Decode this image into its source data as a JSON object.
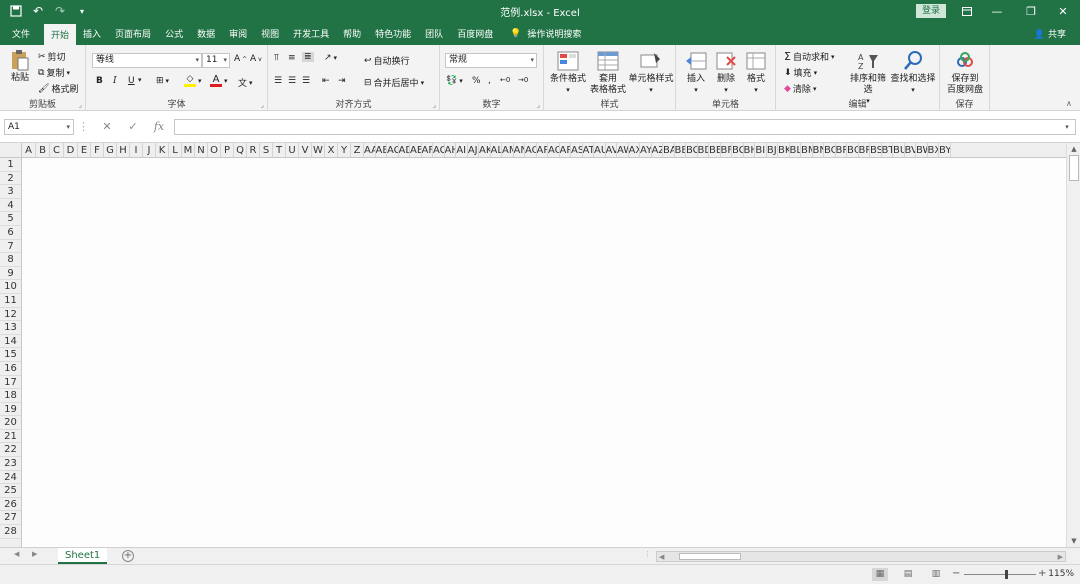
{
  "window": {
    "title": "范例.xlsx - Excel",
    "login_label": "登录",
    "share_label": "共享"
  },
  "tabs": [
    "文件",
    "开始",
    "插入",
    "页面布局",
    "公式",
    "数据",
    "审阅",
    "视图",
    "开发工具",
    "帮助",
    "特色功能",
    "团队",
    "百度网盘",
    "操作说明搜索"
  ],
  "active_tab": "开始",
  "ribbon": {
    "clipboard": {
      "label": "剪贴板",
      "paste": "粘贴",
      "cut": "剪切",
      "copy": "复制",
      "format_painter": "格式刷"
    },
    "font": {
      "label": "字体",
      "font_name": "等线",
      "font_size": "11",
      "bold": "B",
      "italic": "I",
      "underline": "U"
    },
    "alignment": {
      "label": "对齐方式",
      "wrap": "自动换行",
      "merge": "合并后居中"
    },
    "number": {
      "label": "数字",
      "format": "常规",
      "percent": "%"
    },
    "styles": {
      "label": "样式",
      "conditional": "条件格式",
      "table_a": "套用",
      "table_b": "表格格式",
      "cell_styles": "单元格样式"
    },
    "cells": {
      "label": "单元格",
      "insert": "插入",
      "delete": "删除",
      "format": "格式"
    },
    "editing": {
      "label": "编辑",
      "autosum": "自动求和",
      "fill": "填充",
      "clear": "清除",
      "sort": "排序和筛选",
      "find": "查找和选择"
    },
    "save": {
      "label": "保存",
      "save_a": "保存到",
      "save_b": "百度网盘"
    }
  },
  "formula_bar": {
    "name_box": "A1",
    "fx": "fx"
  },
  "columns": [
    "A",
    "B",
    "C",
    "D",
    "E",
    "F",
    "G",
    "H",
    "I",
    "J",
    "K",
    "L",
    "M",
    "N",
    "O",
    "P",
    "Q",
    "R",
    "S",
    "T",
    "U",
    "V",
    "W",
    "X",
    "Y",
    "Z",
    "AA",
    "AB",
    "AC",
    "AD",
    "AE",
    "AF",
    "AG",
    "AH",
    "AI",
    "AJ",
    "AK",
    "AL",
    "AM",
    "AN",
    "AO",
    "AP",
    "AQ",
    "AR",
    "AS",
    "AT",
    "AU",
    "AV",
    "AW",
    "AX",
    "AY",
    "AZ",
    "BA",
    "BB",
    "BC",
    "BD",
    "BE",
    "BF",
    "BG",
    "BH",
    "BI",
    "BJ",
    "BK",
    "BL",
    "BM",
    "BN",
    "BO",
    "BP",
    "BQ",
    "BR",
    "BS",
    "BT",
    "BU",
    "BV",
    "BW",
    "BX",
    "BY"
  ],
  "rows": [
    "1",
    "2",
    "3",
    "4",
    "5",
    "6",
    "7",
    "8",
    "9",
    "10",
    "11",
    "12",
    "13",
    "14",
    "15",
    "16",
    "17",
    "18",
    "19",
    "20",
    "21",
    "22",
    "23",
    "24",
    "25",
    "26",
    "27",
    "28"
  ],
  "sheet": {
    "name": "Sheet1",
    "add": "+"
  },
  "status": {
    "zoom": "115%",
    "zoom_level_pct": 58,
    "minus": "−",
    "plus": "+"
  },
  "colors": {
    "accent": "#217346"
  }
}
